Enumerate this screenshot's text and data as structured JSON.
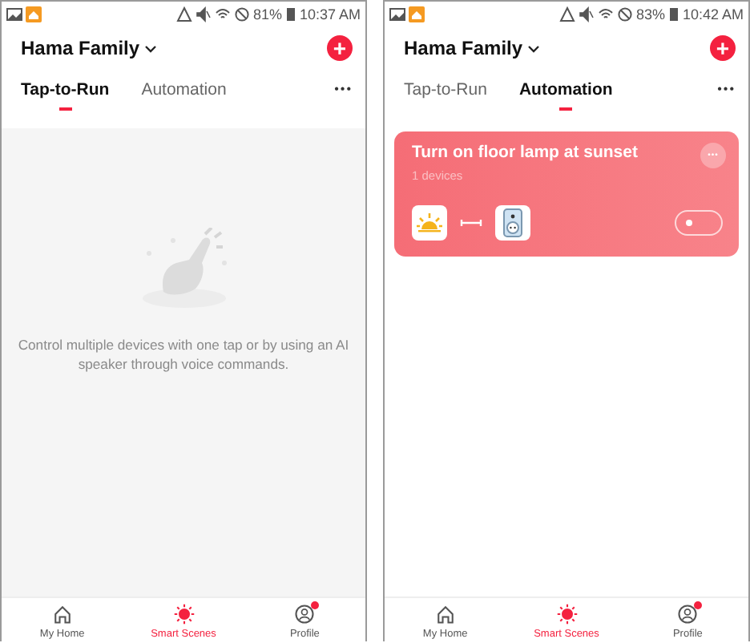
{
  "screens": [
    {
      "status_bar": {
        "battery": "81%",
        "time": "10:37 AM"
      },
      "home_name": "Hama Family",
      "add_button": "+",
      "more_button": "•••",
      "tabs": [
        {
          "label": "Tap-to-Run",
          "selected": true
        },
        {
          "label": "Automation",
          "selected": false
        }
      ],
      "content": {
        "kind": "empty",
        "message": "Control multiple devices with one tap or by using an AI speaker through voice commands."
      },
      "nav": [
        {
          "label": "My Home",
          "selected": false,
          "badge": false
        },
        {
          "label": "Smart Scenes",
          "selected": true,
          "badge": false
        },
        {
          "label": "Profile",
          "selected": false,
          "badge": true
        }
      ]
    },
    {
      "status_bar": {
        "battery": "83%",
        "time": "10:42 AM"
      },
      "home_name": "Hama Family",
      "add_button": "+",
      "more_button": "•••",
      "tabs": [
        {
          "label": "Tap-to-Run",
          "selected": false
        },
        {
          "label": "Automation",
          "selected": true
        }
      ],
      "content": {
        "kind": "scenes",
        "scenes": [
          {
            "title": "Turn on floor lamp at sunset",
            "subtitle": "1 devices",
            "more": "•••",
            "enabled": false
          }
        ]
      },
      "nav": [
        {
          "label": "My Home",
          "selected": false,
          "badge": false
        },
        {
          "label": "Smart Scenes",
          "selected": true,
          "badge": false
        },
        {
          "label": "Profile",
          "selected": false,
          "badge": true
        }
      ]
    }
  ]
}
